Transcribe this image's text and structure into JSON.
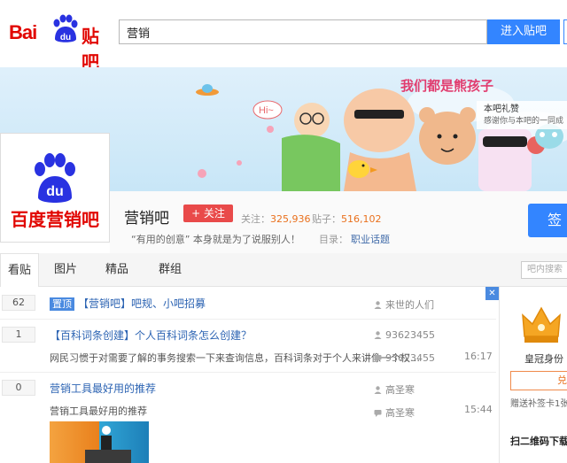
{
  "header": {
    "logo_bai": "Bai",
    "logo_du": "du",
    "logo_tieba": "贴吧",
    "search_value": "营销",
    "enter_button": "进入贴吧"
  },
  "banner": {
    "slogan_art": "我们都是熊孩子",
    "hi_text": "Hi~",
    "gift_title": "本吧礼赞",
    "gift_sub": "感谢你与本吧的一同成"
  },
  "forum": {
    "logo_text": "百度营销吧",
    "logo_du": "du",
    "name": "营销吧",
    "follow_label": "+ 关注",
    "followers_label": "关注：",
    "followers_value": "325,936",
    "posts_label": "贴子：",
    "posts_value": "516,102",
    "slogan": "“有用的创意” 本身就是为了说服别人！",
    "category_label": "目录：",
    "category_value": "职业话题",
    "sign_label": "签"
  },
  "tabs": [
    "看贴",
    "图片",
    "精品",
    "群组"
  ],
  "bar_search_placeholder": "吧内搜索",
  "threads": [
    {
      "replies": "62",
      "badge": "置顶",
      "title": "【营销吧】吧规、小吧招募",
      "author": "来世的人们",
      "abstract": "",
      "last_author": "",
      "time": ""
    },
    {
      "replies": "1",
      "badge": "",
      "title": "【百科词条创建】个人百科词条怎么创建？",
      "author": "93623455",
      "abstract": "网民习惯于对需要了解的事务搜索一下来查询信息，百科词条对于个人来讲像一个权…",
      "last_author": "93623455",
      "time": "16:17"
    },
    {
      "replies": "0",
      "badge": "",
      "title": "营销工具最好用的推荐",
      "author": "高圣寒",
      "abstract": "营销工具最好用的推荐",
      "last_author": "高圣寒",
      "time": "15:44"
    }
  ],
  "rail": {
    "close": "✕",
    "crown_label": "皇冠身份",
    "redeem_label": "兑",
    "gift_note": "赠送补签卡1张",
    "qr_label": "扫二维码下载"
  },
  "colors": {
    "brand_red": "#e10601",
    "accent_blue": "#3385ff",
    "link_blue": "#2d64b3",
    "stat_orange": "#e9701d"
  }
}
